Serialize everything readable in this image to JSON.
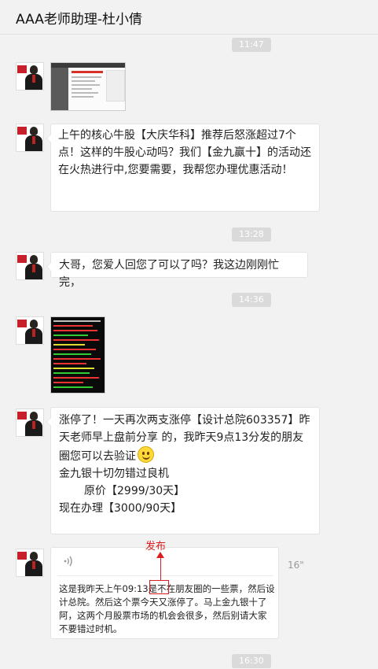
{
  "header": {
    "title": "AAA老师助理-杜小倩"
  },
  "timestamps": [
    "11:47",
    "13:28",
    "14:36",
    "16:30"
  ],
  "messages": {
    "m2": {
      "text": "上午的核心牛股【大庆华科】推荐后怒涨超过7个点！这样的牛股心动吗？我们【金九赢十】的活动还在火热进行中,您要需要，我帮您办理优惠活动！"
    },
    "m3": {
      "text": "大哥，您爱人回您了可以了吗？我这边刚刚忙完，"
    },
    "m5": {
      "line1": "涨停了！一天再次两支涨停【设计总院603357】昨天老师早上盘前分享 的，我昨天9点13分发的朋友圈您可以去验证",
      "line2": "金九银十切勿错过良机",
      "line3": "原价【2999/30天】",
      "line4": "现在办理【3000/90天】"
    },
    "m6": {
      "duration": "16\"",
      "transcript": "这是我昨天上午09:13是不在朋友圈的一些票，然后设计总院。然后这个票今天又涨停了。马上金九银十了阿，这两个月股票市场的机会会很多，然后别请大家不要错过时机。"
    }
  },
  "annotation": {
    "label": "发布"
  },
  "colors": {
    "annotation": "#d81e1e",
    "timestamp_bg": "#dadada",
    "background": "#f2f2f2"
  },
  "icons": {
    "voice": "voice-wave-icon",
    "emoji": "smile-emoji-icon"
  }
}
